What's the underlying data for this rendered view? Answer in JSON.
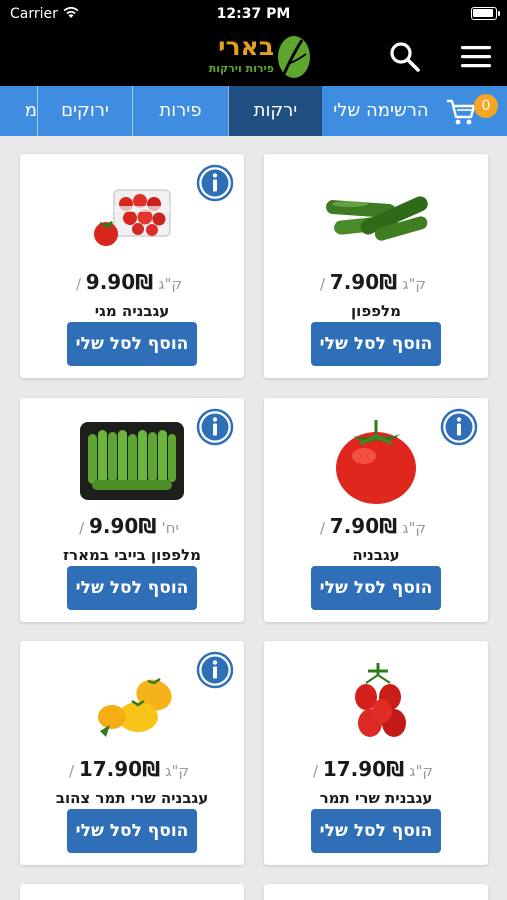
{
  "status_bar": {
    "carrier": "Carrier",
    "time": "12:37 PM"
  },
  "header": {
    "logo_text": "בארי",
    "logo_subtitle": "פירות וירקות"
  },
  "cart": {
    "count": "0"
  },
  "categories": [
    {
      "label": "הרשימה שלי"
    },
    {
      "label": "ירקות"
    },
    {
      "label": "פירות"
    },
    {
      "label": "ירוקים"
    },
    {
      "label": "מ"
    }
  ],
  "add_button_label": "הוסף לסל שלי",
  "products": [
    {
      "name": "עגבניה מגי",
      "price": "9.90₪",
      "unit": "/ ק\"ג",
      "image": "cherry-tomato-box-image"
    },
    {
      "name": "מלפפון",
      "price": "7.90₪",
      "unit": "/ ק\"ג",
      "image": "cucumbers-image"
    },
    {
      "name": "מלפפון בייבי במארז",
      "price": "9.90₪",
      "unit": "/ יח'",
      "image": "baby-cucumber-box-image"
    },
    {
      "name": "עגבניה",
      "price": "7.90₪",
      "unit": "/ ק\"ג",
      "image": "tomato-image"
    },
    {
      "name": "עגבניה שרי תמר צהוב",
      "price": "17.90₪",
      "unit": "/ ק\"ג",
      "image": "yellow-cherry-tomato-image"
    },
    {
      "name": "עגבנית שרי תמר",
      "price": "17.90₪",
      "unit": "/ ק\"ג",
      "image": "red-cherry-tomato-image"
    }
  ],
  "colors": {
    "header_bg": "#000000",
    "category_bar": "#3e8de0",
    "category_active": "#1f4e80",
    "add_button": "#2f6fb8",
    "info_icon": "#2f6fb8",
    "logo_orange": "#e39f1d",
    "logo_green": "#5fa62f",
    "cart_badge": "#f5a623"
  }
}
